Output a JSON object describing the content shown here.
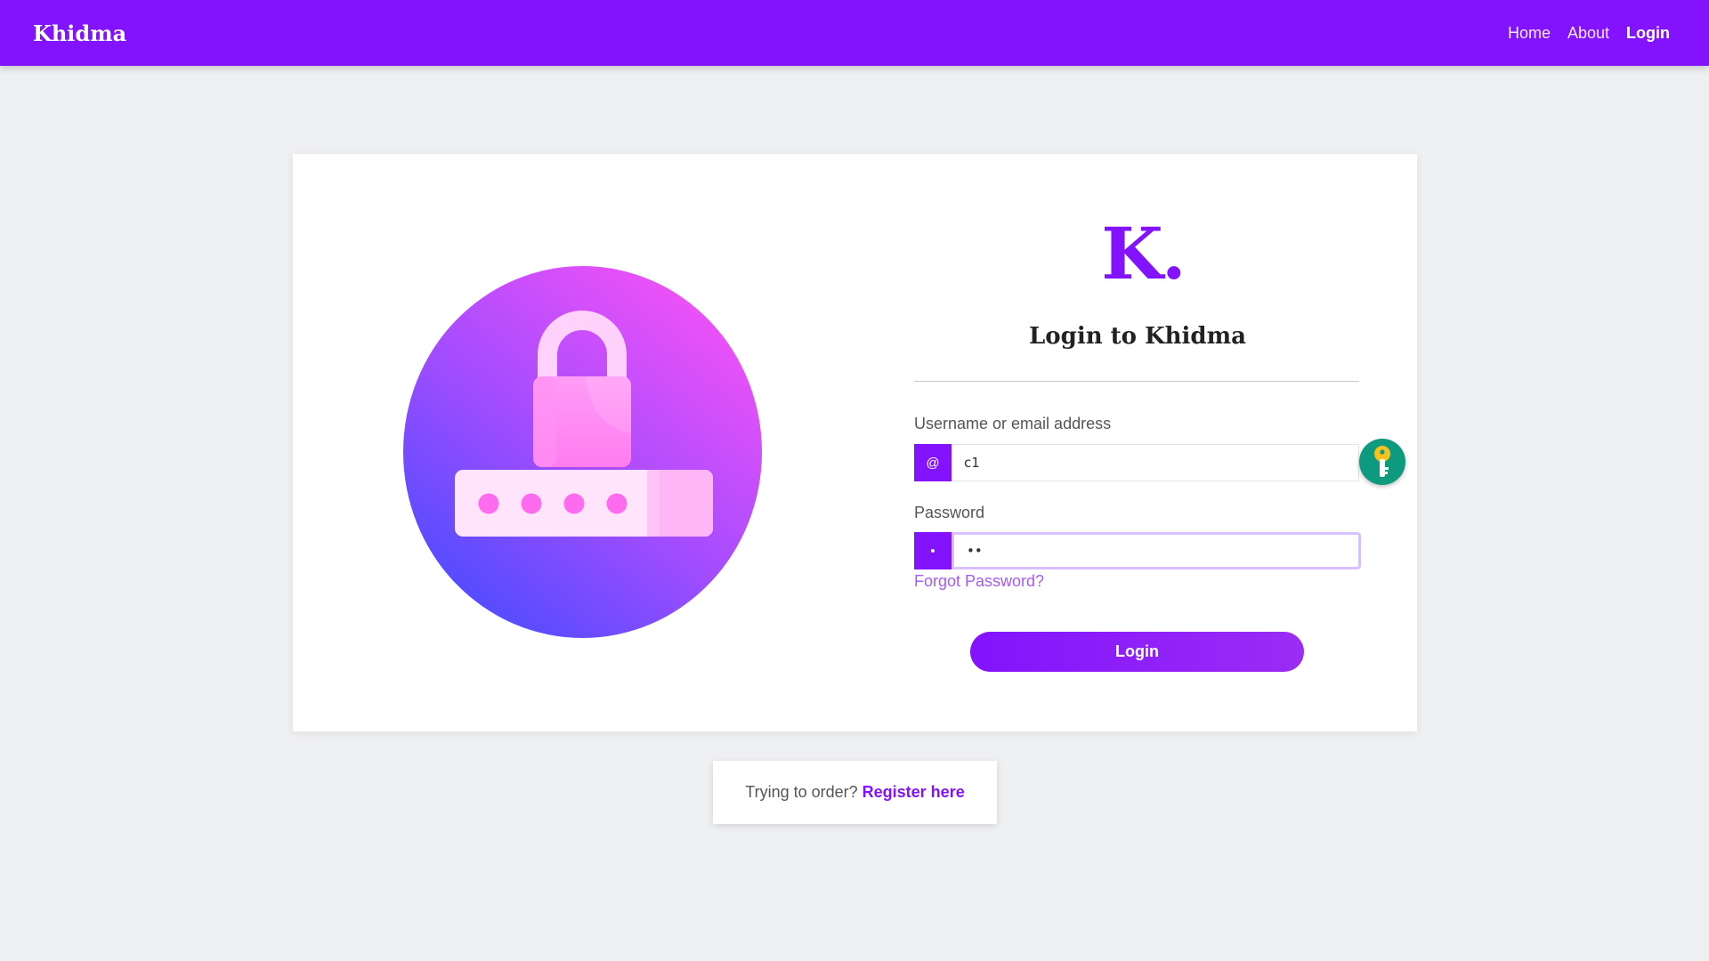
{
  "navbar": {
    "brand": "Khidma",
    "links": [
      {
        "label": "Home"
      },
      {
        "label": "About"
      },
      {
        "label": "Login"
      }
    ],
    "active": "Login",
    "color": "#8213fc"
  },
  "card": {
    "logo": "K.",
    "title": "Login to Khidma",
    "username": {
      "label": "Username or email address",
      "addon": "@",
      "value": "c1"
    },
    "password": {
      "label": "Password",
      "addon": "•",
      "value": "••"
    },
    "forgot_label": "Forgot Password?",
    "login_label": "Login",
    "illustration_icon": "padlock-password-icon",
    "extension_icon": "key-icon"
  },
  "register": {
    "text": "Trying to order?",
    "link": "Register here"
  }
}
